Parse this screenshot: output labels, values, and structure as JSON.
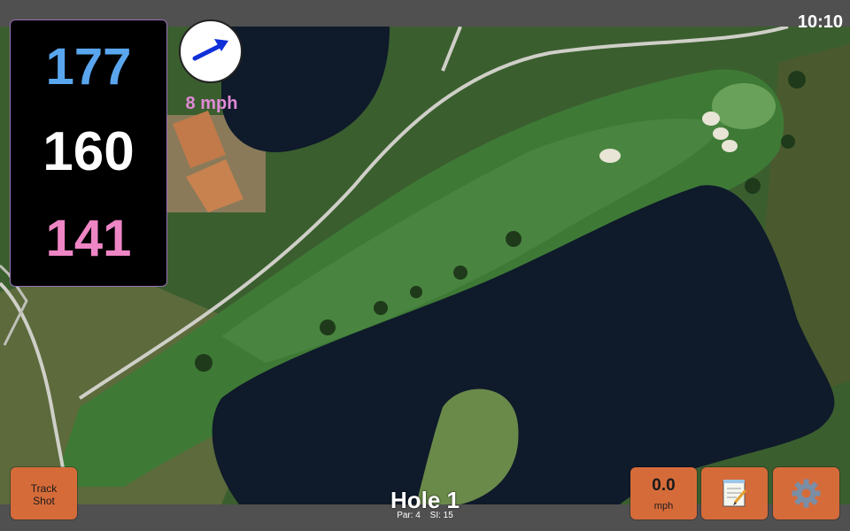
{
  "status": {
    "time": "10:10"
  },
  "distances": {
    "back": "177",
    "middle": "160",
    "front": "141"
  },
  "wind": {
    "speed": "8 mph",
    "direction_icon": "wind-arrow-icon"
  },
  "hole": {
    "title": "Hole 1",
    "par": "Par: 4",
    "stroke_index": "SI: 15"
  },
  "buttons": {
    "track_shot_line1": "Track",
    "track_shot_line2": "Shot",
    "speed_value": "0.0",
    "speed_unit": "mph",
    "notes_icon": "notepad-icon",
    "settings_icon": "gear-icon"
  },
  "colors": {
    "back_distance": "#5aa6ee",
    "middle_distance": "#ffffff",
    "front_distance": "#ee85c4",
    "button": "#d66b3a",
    "water": "#0f1a2a",
    "fairway": "#3e7a36"
  }
}
